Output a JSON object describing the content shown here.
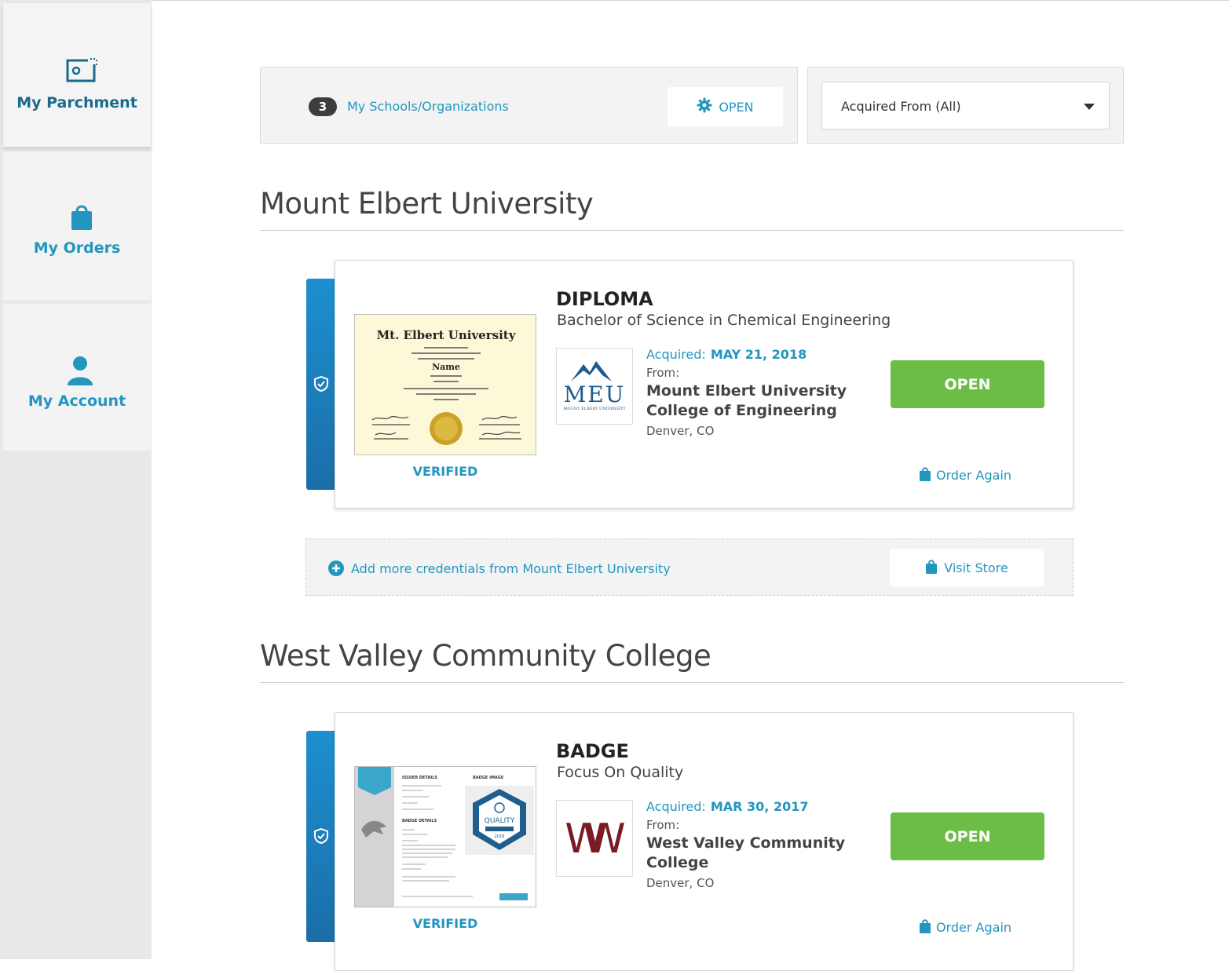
{
  "sidebar": {
    "items": [
      {
        "label": "My Parchment",
        "icon": "parchment-card-icon"
      },
      {
        "label": "My Orders",
        "icon": "shopping-bag-icon"
      },
      {
        "label": "My Account",
        "icon": "user-icon"
      }
    ]
  },
  "filters": {
    "schools_count": "3",
    "schools_label": "My Schools/Organizations",
    "open_label": "OPEN",
    "acquired_from": "Acquired From (All)"
  },
  "sections": [
    {
      "title": "Mount Elbert University",
      "credential": {
        "type": "DIPLOMA",
        "name": "Bachelor of Science in Chemical Engineering",
        "verified": "VERIFIED",
        "acquired_label": "Acquired:",
        "acquired_date": "MAY 21, 2018",
        "from_label": "From:",
        "school": "Mount Elbert University College of Engineering",
        "location": "Denver, CO",
        "open_label": "OPEN",
        "order_again": "Order Again",
        "logo_text": "MEU",
        "logo_subtext": "MOUNT ELBERT UNIVERSITY",
        "thumb": {
          "title": "Mt. Elbert University",
          "name": "Name"
        }
      },
      "add_more": "Add more credentials from Mount Elbert University",
      "visit_store": "Visit Store"
    },
    {
      "title": "West Valley Community College",
      "credential": {
        "type": "BADGE",
        "name": "Focus On Quality",
        "verified": "VERIFIED",
        "acquired_label": "Acquired:",
        "acquired_date": "MAR 30, 2017",
        "from_label": "From:",
        "school": "West Valley Community College",
        "location": "Denver, CO",
        "open_label": "OPEN",
        "order_again": "Order Again",
        "logo_text": "W",
        "thumb": {
          "issuer_details": "ISSUER DETAILS",
          "badge_image": "BADGE IMAGE",
          "badge_details": "BADGE DETAILS",
          "badge_word": "QUALITY",
          "year": "2018"
        }
      }
    }
  ],
  "colors": {
    "accent": "#2396c0",
    "open_green": "#6cbd45",
    "stripe_blue": "#1d8fd0"
  }
}
